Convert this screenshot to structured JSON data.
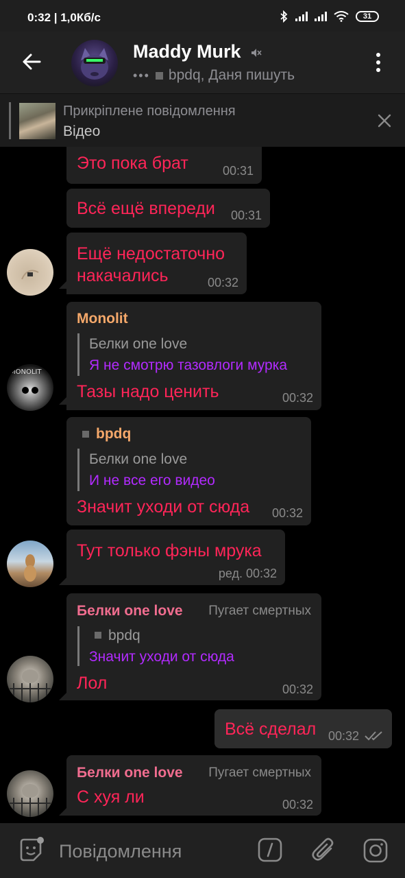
{
  "status_bar": {
    "time": "0:32 | 1,0Кб/с",
    "battery": "31"
  },
  "header": {
    "title": "Maddy Murk",
    "typing_dots": "•••",
    "typing_text": "bpdq, Даня пишуть"
  },
  "pinned": {
    "title": "Прикріплене повідомлення",
    "subtitle": "Відео"
  },
  "messages": [
    {
      "text": "Это пока брат",
      "time": "00:31"
    },
    {
      "text": "Всё ещё впереди",
      "time": "00:31"
    },
    {
      "line1": "Ещё недостаточно",
      "line2": "накачались",
      "time": "00:32"
    },
    {
      "sender": "Monolit",
      "quote_name": "Белки one love",
      "quote_text": "Я не смотрю тазовлоги мурка",
      "text": "Тазы надо ценить",
      "time": "00:32"
    },
    {
      "sender": "bpdq",
      "quote_name": "Белки one love",
      "quote_text": "И не все его видео",
      "text": "Значит уходи от сюда",
      "time": "00:32"
    },
    {
      "text": "Тут только фэны мрука",
      "time": "ред. 00:32"
    },
    {
      "sender": "Белки one love",
      "rank": "Пугает смертных",
      "quote_name": "bpdq",
      "quote_text": "Значит уходи от сюда",
      "text": "Лол",
      "time": "00:32"
    },
    {
      "text": "Всё сделал",
      "time": "00:32"
    },
    {
      "sender": "Белки one love",
      "rank": "Пугает смертных",
      "text": "С хуя ли",
      "time": "00:32"
    }
  ],
  "input": {
    "placeholder": "Повідомлення"
  },
  "colors": {
    "message_text": "#ff2558",
    "quote_text": "#b22bff",
    "sender_orange": "#f5a86a",
    "sender_pink": "#f06d8f",
    "bubble": "#212121",
    "background": "#000000"
  }
}
